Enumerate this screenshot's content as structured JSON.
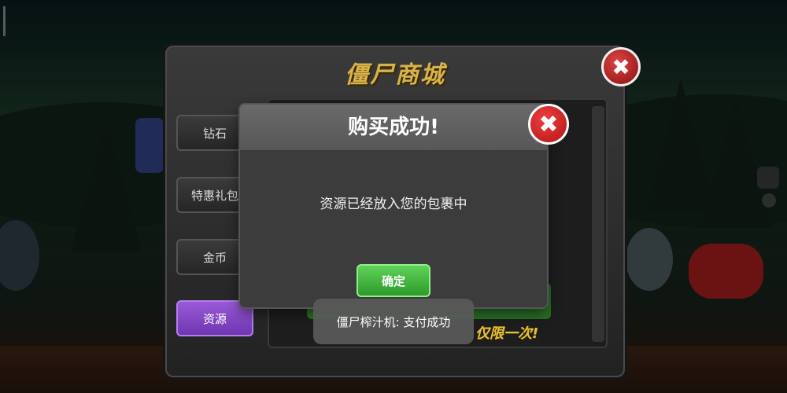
{
  "shop": {
    "title": "僵尸商城",
    "close_icon": "close-icon",
    "tabs": [
      {
        "label": "钻石",
        "active": false
      },
      {
        "label": "特惠礼包",
        "active": false
      },
      {
        "label": "金币",
        "active": false
      },
      {
        "label": "资源",
        "active": true
      }
    ],
    "promo_text": "仅限一次!"
  },
  "dialog": {
    "title": "购买成功!",
    "message": "资源已经放入您的包裹中",
    "confirm_label": "确定",
    "close_icon": "close-icon"
  },
  "toast": {
    "text": "僵尸榨汁机: 支付成功"
  },
  "colors": {
    "close_red": "#c81e1e",
    "confirm_green": "#3fb33a",
    "active_tab_purple": "#8246c8",
    "title_gold": "#d8b24a"
  }
}
